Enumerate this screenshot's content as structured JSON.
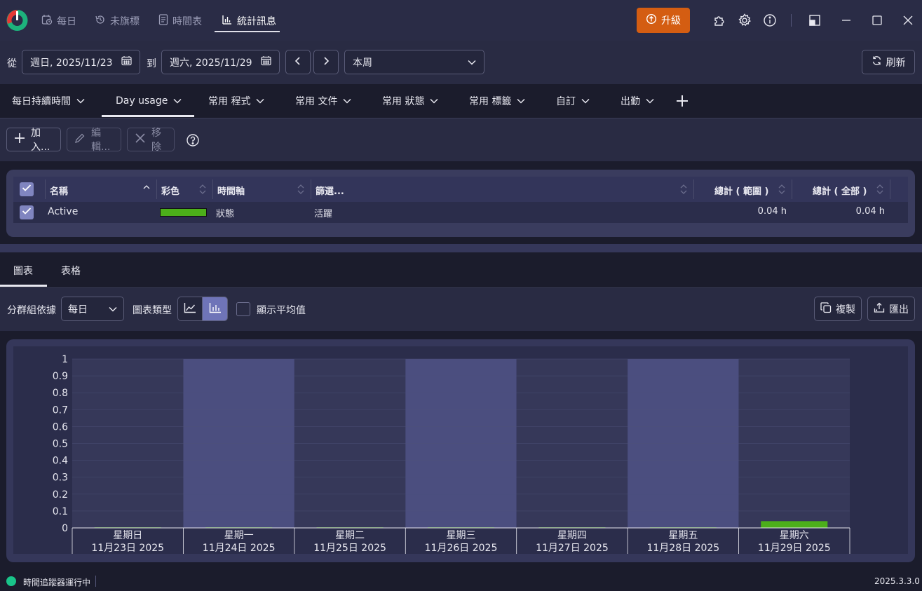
{
  "nav": {
    "tabs": [
      {
        "label": "每日",
        "icon": "clock-calendar-icon"
      },
      {
        "label": "未旗標",
        "icon": "history-icon"
      },
      {
        "label": "時間表",
        "icon": "document-icon"
      },
      {
        "label": "統計訊息",
        "icon": "bar-chart-icon"
      }
    ],
    "active_index": 3,
    "upgrade_label": "升級"
  },
  "toolbar": {
    "from_label": "從",
    "from_date": "週日, 2025/11/23",
    "to_label": "到",
    "to_date": "週六, 2025/11/29",
    "period": "本周",
    "refresh_label": "刷新"
  },
  "view_tabs": {
    "items": [
      "每日持續時間",
      "Day usage",
      "常用 程式",
      "常用 文件",
      "常用 狀態",
      "常用 標籤",
      "自訂",
      "出勤"
    ],
    "active_index": 1
  },
  "actions": {
    "add": "加入...",
    "edit": "編輯...",
    "remove": "移除"
  },
  "table": {
    "headers": {
      "name": "名稱",
      "color": "彩色",
      "timeline": "時間軸",
      "filter": "篩選...",
      "total_range": "總計 ( 範圍 )",
      "total_all": "總計 ( 全部 )"
    },
    "rows": [
      {
        "name": "Active",
        "color": "#4caf1a",
        "timeline": "狀態",
        "filter": "活躍",
        "total_range": "0.04 h",
        "total_all": "0.04 h"
      }
    ]
  },
  "chart_tabs": {
    "items": [
      "圖表",
      "表格"
    ],
    "active_index": 0
  },
  "chart_options": {
    "group_by_label": "分群組依據",
    "group_by_value": "每日",
    "chart_type_label": "圖表類型",
    "show_avg_label": "顯示平均值",
    "copy_label": "複製",
    "export_label": "匯出"
  },
  "chart_data": {
    "type": "bar",
    "categories": [
      "星期日",
      "星期一",
      "星期二",
      "星期三",
      "星期四",
      "星期五",
      "星期六"
    ],
    "dates": [
      "11月23日 2025",
      "11月24日 2025",
      "11月25日 2025",
      "11月26日 2025",
      "11月27日 2025",
      "11月28日 2025",
      "11月29日 2025"
    ],
    "series": [
      {
        "name": "Active",
        "color": "#4caf1a",
        "values": [
          0,
          0,
          0,
          0,
          0,
          0,
          0.04
        ]
      }
    ],
    "ylim": [
      0,
      1
    ],
    "yticks": [
      "0",
      "0.1",
      "0.2",
      "0.3",
      "0.4",
      "0.5",
      "0.6",
      "0.7",
      "0.8",
      "0.9",
      "1"
    ],
    "grid": true
  },
  "status": {
    "tracker_text": "時間追蹤器運行中",
    "version": "2025.3.3.0"
  }
}
